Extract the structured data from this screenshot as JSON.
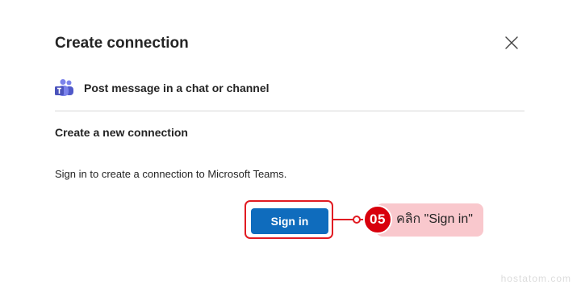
{
  "dialog": {
    "title": "Create connection",
    "close_icon": "close-icon"
  },
  "action": {
    "icon": "microsoft-teams-icon",
    "label": "Post message in a chat or channel"
  },
  "section": {
    "heading": "Create a new connection",
    "description": "Sign in to create a connection to Microsoft Teams."
  },
  "buttons": {
    "sign_in": "Sign in"
  },
  "annotation": {
    "step_number": "05",
    "callout_text": "คลิก \"Sign in\"",
    "highlight_color": "#e11b22",
    "callout_background": "#f9c8cd"
  },
  "watermark": "hostatom.com",
  "colors": {
    "primary_button": "#0f6cbd",
    "text": "#242424",
    "divider": "#d6d6d6"
  }
}
